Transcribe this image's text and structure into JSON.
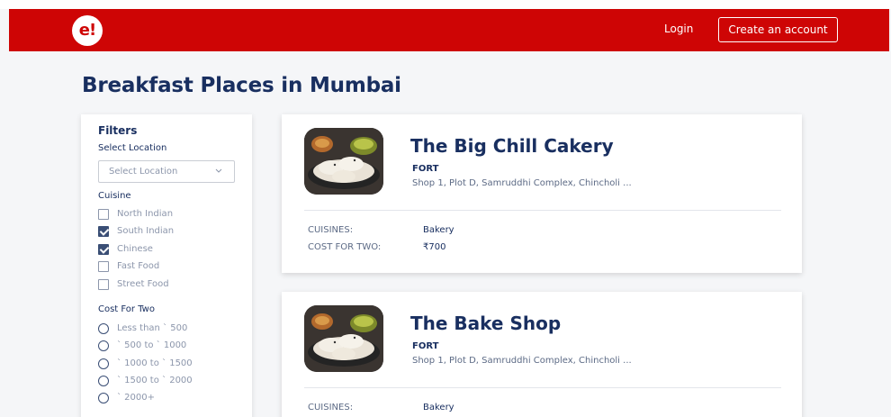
{
  "header": {
    "logo_text": "e!",
    "login_label": "Login",
    "create_account_label": "Create an account"
  },
  "page_title": "Breakfast Places in Mumbai",
  "filters": {
    "title": "Filters",
    "select_location_label": "Select Location",
    "select_location_placeholder": "Select Location",
    "cuisine_label": "Cuisine",
    "cuisines": [
      {
        "label": "North Indian",
        "checked": false
      },
      {
        "label": "South Indian",
        "checked": true
      },
      {
        "label": "Chinese",
        "checked": true
      },
      {
        "label": "Fast Food",
        "checked": false
      },
      {
        "label": "Street Food",
        "checked": false
      }
    ],
    "cost_label": "Cost For Two",
    "costs": [
      {
        "label": "Less than ` 500"
      },
      {
        "label": "` 500 to ` 1000"
      },
      {
        "label": "` 1000 to ` 1500"
      },
      {
        "label": "` 1500 to ` 2000"
      },
      {
        "label": "` 2000+"
      }
    ]
  },
  "restaurants": [
    {
      "name": "The Big Chill Cakery",
      "area": "FORT",
      "address": "Shop 1, Plot D, Samruddhi Complex, Chincholi ...",
      "cuisines_key": "CUISINES:",
      "cuisines_value": "Bakery",
      "cost_key": "COST FOR TWO:",
      "cost_value": "₹700"
    },
    {
      "name": "The Bake Shop",
      "area": "FORT",
      "address": "Shop 1, Plot D, Samruddhi Complex, Chincholi ...",
      "cuisines_key": "CUISINES:",
      "cuisines_value": "Bakery"
    }
  ],
  "colors": {
    "brand_red": "#ce0505",
    "navy": "#192f60",
    "muted": "#8c96ab",
    "page_bg": "#f5f6f8"
  }
}
